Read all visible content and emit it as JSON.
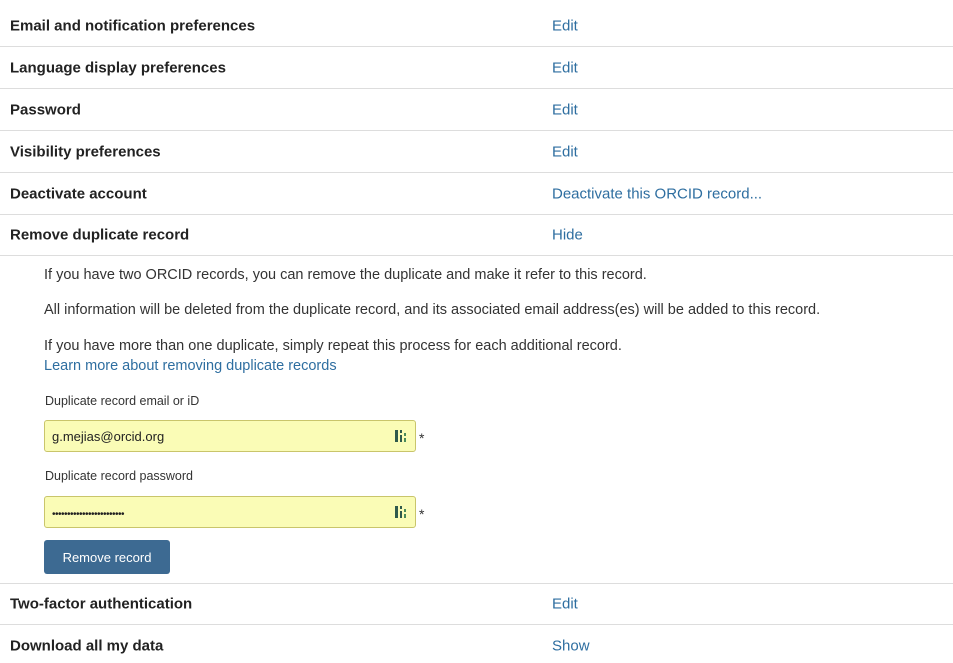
{
  "settings_rows": [
    {
      "label": "Email and notification preferences",
      "action": "Edit"
    },
    {
      "label": "Language display preferences",
      "action": "Edit"
    },
    {
      "label": "Password",
      "action": "Edit"
    },
    {
      "label": "Visibility preferences",
      "action": "Edit"
    },
    {
      "label": "Deactivate account",
      "action": "Deactivate this ORCID record..."
    },
    {
      "label": "Remove duplicate record",
      "action": "Hide"
    }
  ],
  "duplicate_panel": {
    "paragraph_1": "If you have two ORCID records, you can remove the duplicate and make it refer to this record.",
    "paragraph_2": "All information will be deleted from the duplicate record, and its associated email address(es) will be added to this record.",
    "paragraph_3": "If you have more than one duplicate, simply repeat this process for each additional record.",
    "learn_more_link": "Learn more about removing duplicate records",
    "email_field": {
      "label": "Duplicate record email or iD",
      "value": "g.mejias@orcid.org",
      "required_marker": "*"
    },
    "password_field": {
      "label": "Duplicate record password",
      "value": "••••••••••••••••••••••••",
      "required_marker": "*"
    },
    "submit_label": "Remove record"
  },
  "bottom_rows": [
    {
      "label": "Two-factor authentication",
      "action": "Edit"
    },
    {
      "label": "Download all my data",
      "action": "Show"
    }
  ],
  "icons": {
    "password_manager": "password-manager-key-icon"
  },
  "colors": {
    "link": "#2e6ea0",
    "button": "#3d6a92",
    "autofill_bg": "#fafcb6",
    "divider": "#dddddd"
  }
}
